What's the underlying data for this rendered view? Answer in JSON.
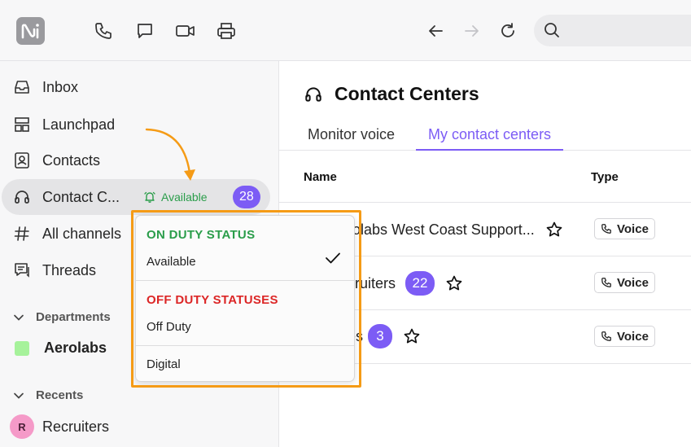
{
  "topbar": {
    "logo_text": "Ni",
    "icons": [
      "phone-icon",
      "chat-bubble-icon",
      "video-icon",
      "printer-icon",
      "back-arrow-icon",
      "forward-arrow-icon",
      "refresh-icon",
      "search-icon"
    ]
  },
  "sidebar": {
    "items": [
      {
        "label": "Inbox",
        "icon": "inbox-icon"
      },
      {
        "label": "Launchpad",
        "icon": "launchpad-icon"
      },
      {
        "label": "Contacts",
        "icon": "contacts-icon"
      },
      {
        "label": "Contact C...",
        "icon": "headset-icon",
        "status": "Available",
        "badge": "28"
      },
      {
        "label": "All channels",
        "icon": "hash-icon"
      },
      {
        "label": "Threads",
        "icon": "threads-icon"
      }
    ],
    "departments": {
      "label": "Departments",
      "items": [
        {
          "label": "Aerolabs",
          "color": "#a6f29b"
        }
      ]
    },
    "recents": {
      "label": "Recents",
      "items": [
        {
          "label": "Recruiters",
          "initial": "R",
          "color": "#f59ac8"
        }
      ]
    }
  },
  "main": {
    "title": "Contact Centers",
    "tabs": [
      {
        "label": "Monitor voice",
        "active": false
      },
      {
        "label": "My contact centers",
        "active": true
      }
    ],
    "columns": {
      "name": "Name",
      "type": "Type"
    },
    "rows": [
      {
        "name": "rolabs West Coast Support...",
        "badge": "",
        "type": "Voice"
      },
      {
        "name": "cruiters",
        "badge": "22",
        "type": "Voice"
      },
      {
        "name": "es",
        "badge": "3",
        "type": "Voice"
      }
    ]
  },
  "dropdown": {
    "on_duty_heading": "ON DUTY STATUS",
    "on_duty_items": [
      {
        "label": "Available",
        "selected": true
      }
    ],
    "off_duty_heading": "OFF DUTY STATUSES",
    "off_duty_items": [
      {
        "label": "Off Duty"
      }
    ],
    "other_items": [
      {
        "label": "Digital"
      }
    ]
  },
  "colors": {
    "accent": "#7c5cf5",
    "on_duty": "#2a9d4a",
    "off_duty": "#dc2626",
    "highlight": "#f59b16"
  }
}
